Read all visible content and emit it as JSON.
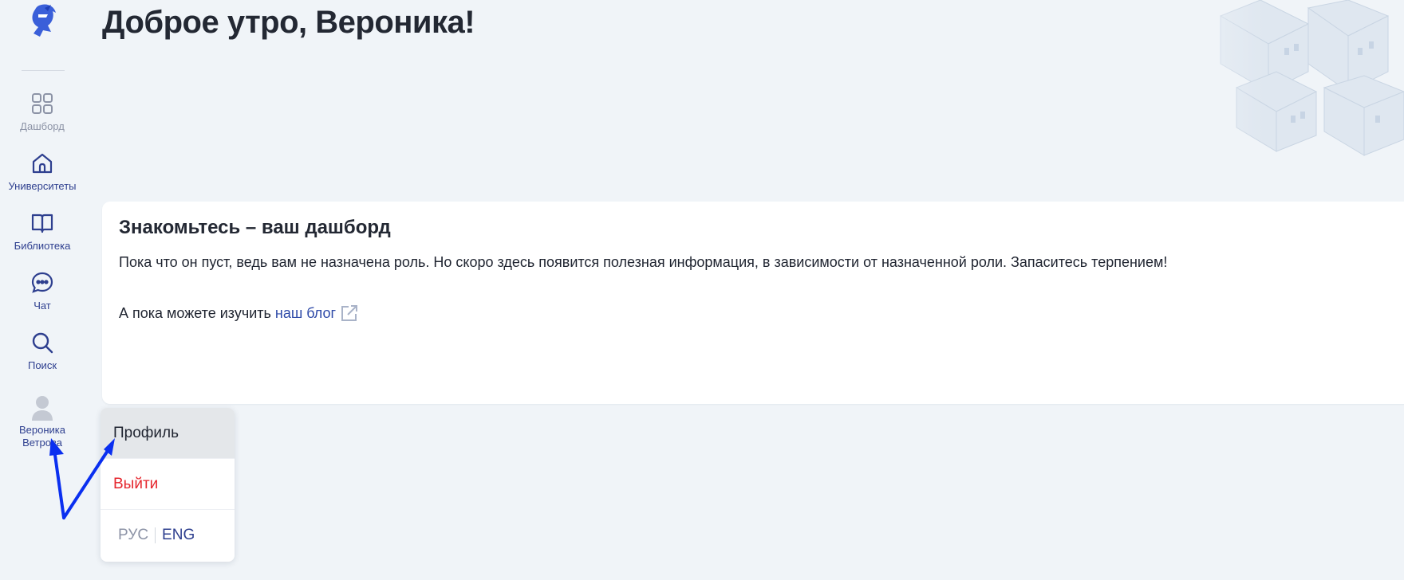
{
  "header": {
    "greeting": "Доброе утро, Вероника!"
  },
  "sidebar": {
    "logo_icon": "knight-helmet-logo-icon",
    "items": [
      {
        "label": "Дашборд",
        "icon": "grid-icon"
      },
      {
        "label": "Университеты",
        "icon": "home-icon"
      },
      {
        "label": "Библиотека",
        "icon": "book-icon"
      },
      {
        "label": "Чат",
        "icon": "chat-icon"
      },
      {
        "label": "Поиск",
        "icon": "search-icon"
      }
    ],
    "user": {
      "first_name": "Вероника",
      "last_name": "Ветрова",
      "icon": "avatar-icon"
    }
  },
  "card": {
    "title": "Знакомьтесь – ваш дашборд",
    "text": "Пока что он пуст, ведь вам не назначена роль. Но скоро здесь появится полезная информация, в зависимости от назначенной роли. Запаситесь терпением!",
    "link_prefix": "А пока можете изучить",
    "link_label": "наш блог",
    "link_icon": "external-link-icon"
  },
  "user_menu": {
    "profile": "Профиль",
    "logout": "Выйти",
    "lang_ru": "РУС",
    "lang_en": "ENG"
  },
  "colors": {
    "accent": "#2e3f8f",
    "link": "#2e4aa8",
    "danger": "#e5262d",
    "background": "#f0f4f8",
    "annotation_arrow": "#0a2ff0"
  }
}
